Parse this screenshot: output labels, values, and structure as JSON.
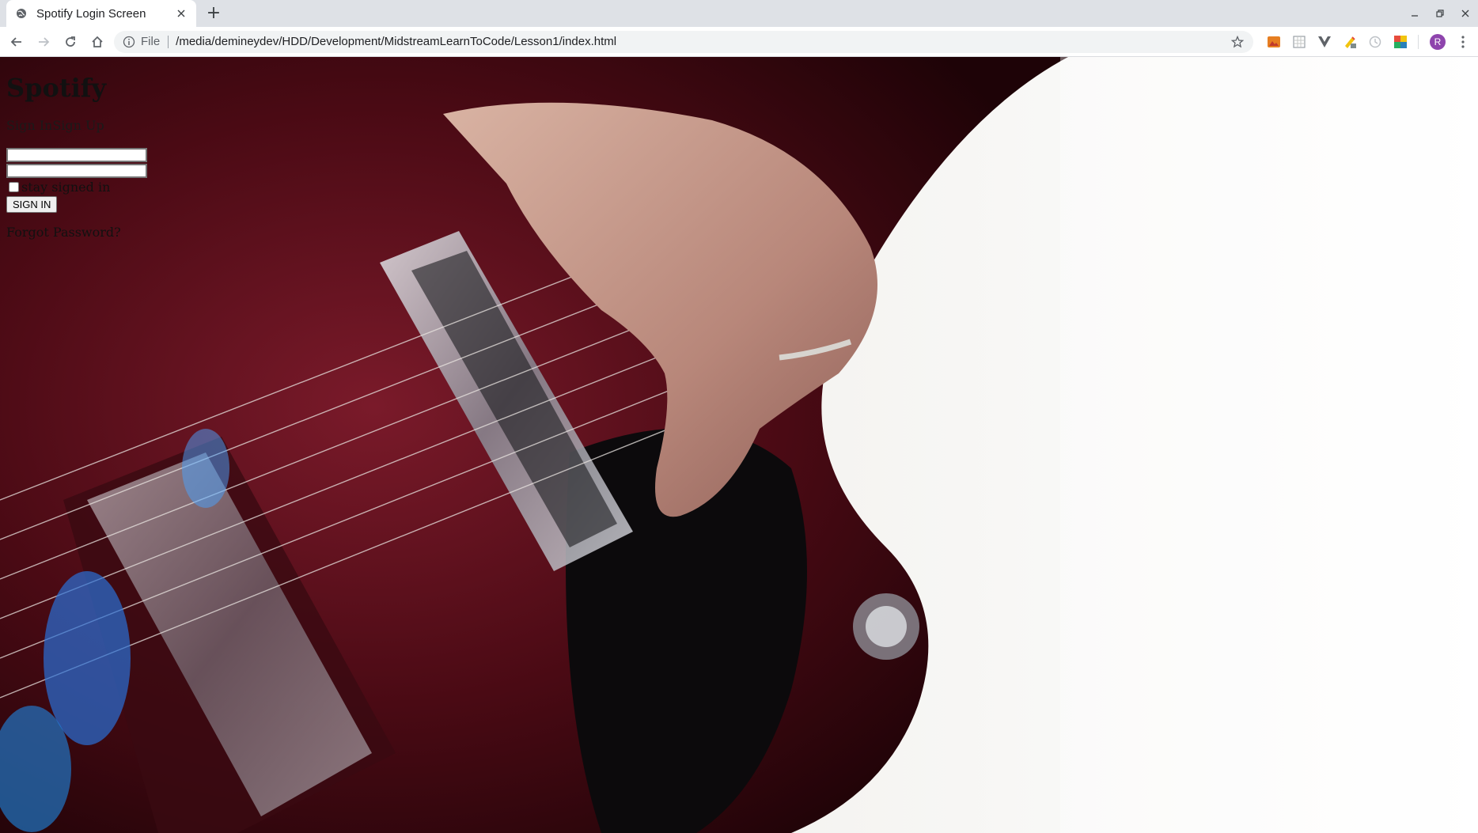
{
  "browser": {
    "tab_title": "Spotify Login Screen",
    "new_tab_symbol": "+",
    "scheme_label": "File",
    "url": "/media/demineydev/HDD/Development/MidstreamLearnToCode/Lesson1/index.html",
    "profile_initial": "R",
    "icons": [
      "globe-icon",
      "close-icon",
      "plus-icon",
      "minimize-icon",
      "restore-icon",
      "window-close-icon",
      "back-icon",
      "forward-icon",
      "reload-icon",
      "home-icon",
      "info-icon",
      "star-icon",
      "menu-dots-icon"
    ]
  },
  "page": {
    "title": "Spotify",
    "tab_signin": "Sign In",
    "tab_signup": "Sign Up",
    "username_value": "",
    "password_value": "",
    "stay_signed_in_label": "stay signed in",
    "stay_signed_in_checked": false,
    "signin_button": "SIGN IN",
    "forgot_password": "Forgot Password?"
  },
  "colors": {
    "tabstrip": "#dee1e6",
    "omnibox": "#f1f3f4",
    "guitar_body": "#5a0f1a",
    "avatar": "#8e44ad"
  }
}
